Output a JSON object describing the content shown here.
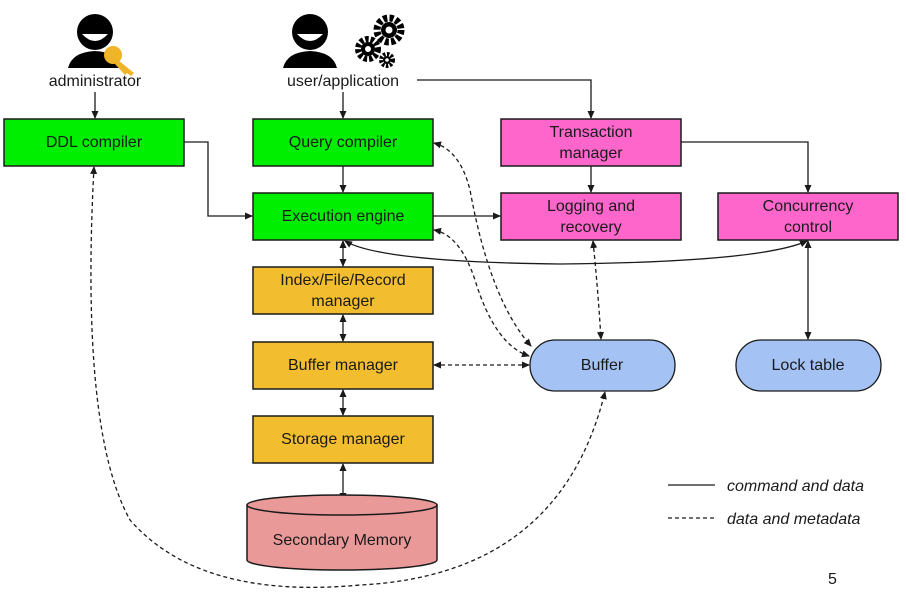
{
  "actors": {
    "administrator": "administrator",
    "user_application": "user/application"
  },
  "components": {
    "ddl_compiler": "DDL compiler",
    "query_compiler": "Query compiler",
    "execution_engine": "Execution engine",
    "index_file_record_manager": [
      "Index/File/Record",
      "manager"
    ],
    "buffer_manager": "Buffer manager",
    "storage_manager": "Storage manager",
    "secondary_memory": "Secondary Memory",
    "transaction_manager": [
      "Transaction",
      "manager"
    ],
    "logging_recovery": [
      "Logging and",
      "recovery"
    ],
    "concurrency_control": [
      "Concurrency",
      "control"
    ],
    "buffer": "Buffer",
    "lock_table": "Lock table"
  },
  "legend": {
    "solid": "command and data",
    "dashed": "data and metadata"
  },
  "page_number": "5",
  "colors": {
    "green": "#00ee00",
    "orange": "#f2be2f",
    "magenta": "#ff66cc",
    "blue": "#a4c2f4",
    "memory": "#ea9999",
    "key": "#f0b429"
  }
}
